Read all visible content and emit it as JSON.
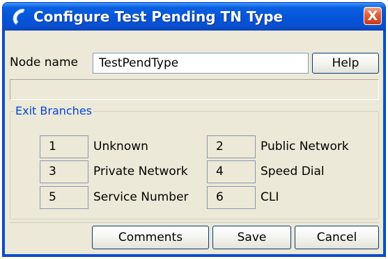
{
  "window": {
    "title": "Configure Test Pending TN Type",
    "close_label": "X",
    "accent": "#0454d8"
  },
  "form": {
    "node_name_label": "Node name",
    "node_name_value": "TestPendType",
    "help_label": "Help",
    "status_text": ""
  },
  "exit_branches": {
    "title": "Exit Branches",
    "items": [
      {
        "number": "1",
        "label": "Unknown"
      },
      {
        "number": "2",
        "label": "Public Network"
      },
      {
        "number": "3",
        "label": "Private Network"
      },
      {
        "number": "4",
        "label": "Speed Dial"
      },
      {
        "number": "5",
        "label": "Service Number"
      },
      {
        "number": "6",
        "label": "CLI"
      }
    ]
  },
  "buttons": {
    "comments_label": "Comments",
    "save_label": "Save",
    "cancel_label": "Cancel"
  },
  "icons": {
    "title_icon": "phone-handset-icon",
    "close_icon": "close-icon"
  }
}
